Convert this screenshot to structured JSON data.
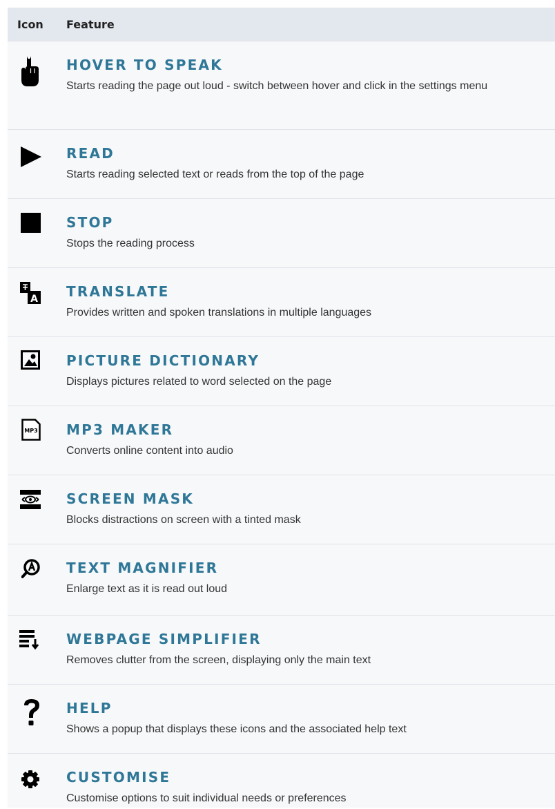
{
  "header": {
    "icon_col": "Icon",
    "feature_col": "Feature"
  },
  "features": [
    {
      "icon": "pointing-hand-icon",
      "title": "HOVER TO SPEAK",
      "description": "Starts reading the page out loud - switch between hover and click in the settings menu"
    },
    {
      "icon": "play-icon",
      "title": "READ",
      "description": "Starts reading selected text or reads from the top of the page"
    },
    {
      "icon": "stop-icon",
      "title": "STOP",
      "description": "Stops the reading process"
    },
    {
      "icon": "translate-icon",
      "title": "TRANSLATE",
      "description": "Provides written and spoken translations in multiple languages"
    },
    {
      "icon": "picture-icon",
      "title": "PICTURE DICTIONARY",
      "description": "Displays pictures related to word selected on the page"
    },
    {
      "icon": "mp3-icon",
      "title": "MP3 MAKER",
      "description": "Converts online content into audio"
    },
    {
      "icon": "screen-mask-icon",
      "title": "SCREEN MASK",
      "description": "Blocks distractions on screen with a tinted mask"
    },
    {
      "icon": "magnifier-icon",
      "title": "TEXT MAGNIFIER",
      "description": "Enlarge text as it is read out loud"
    },
    {
      "icon": "simplifier-icon",
      "title": "WEBPAGE SIMPLIFIER",
      "description": "Removes clutter from the screen, displaying only the main text"
    },
    {
      "icon": "help-icon",
      "title": "HELP",
      "description": "Shows a popup that displays these icons and the associated help text"
    },
    {
      "icon": "gear-icon",
      "title": "CUSTOMISE",
      "description": "Customise options to suit individual needs or preferences"
    }
  ],
  "mp3_icon_text": "MP3",
  "translate_icon_letter": "A"
}
